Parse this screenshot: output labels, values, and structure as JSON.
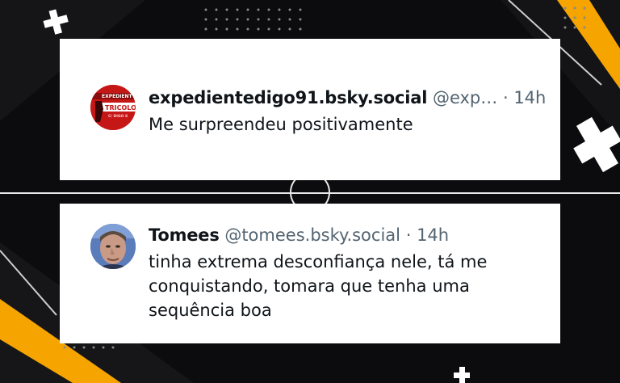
{
  "posts": [
    {
      "display_name": "expedientedigo91.bsky.social",
      "handle": "@exp…",
      "separator": "·",
      "time": "14h",
      "text": "Me surpreendeu positivamente",
      "avatar": {
        "icon": "red-club-logo-avatar",
        "texts": [
          "EXPEDIENT",
          "TRICOLO",
          "C/ DIGO S"
        ]
      }
    },
    {
      "display_name": "Tomees",
      "handle": "@tomees.bsky.social",
      "separator": "·",
      "time": "14h",
      "text": "tinha extrema desconfiança nele, tá me conquistando, tomara que tenha uma sequência boa",
      "avatar": {
        "icon": "man-face-photo-avatar"
      }
    }
  ],
  "colors": {
    "background": "#0c0c0e",
    "accent_yellow": "#f5a400",
    "card": "#ffffff",
    "name": "#0f1419",
    "muted": "#536471"
  }
}
